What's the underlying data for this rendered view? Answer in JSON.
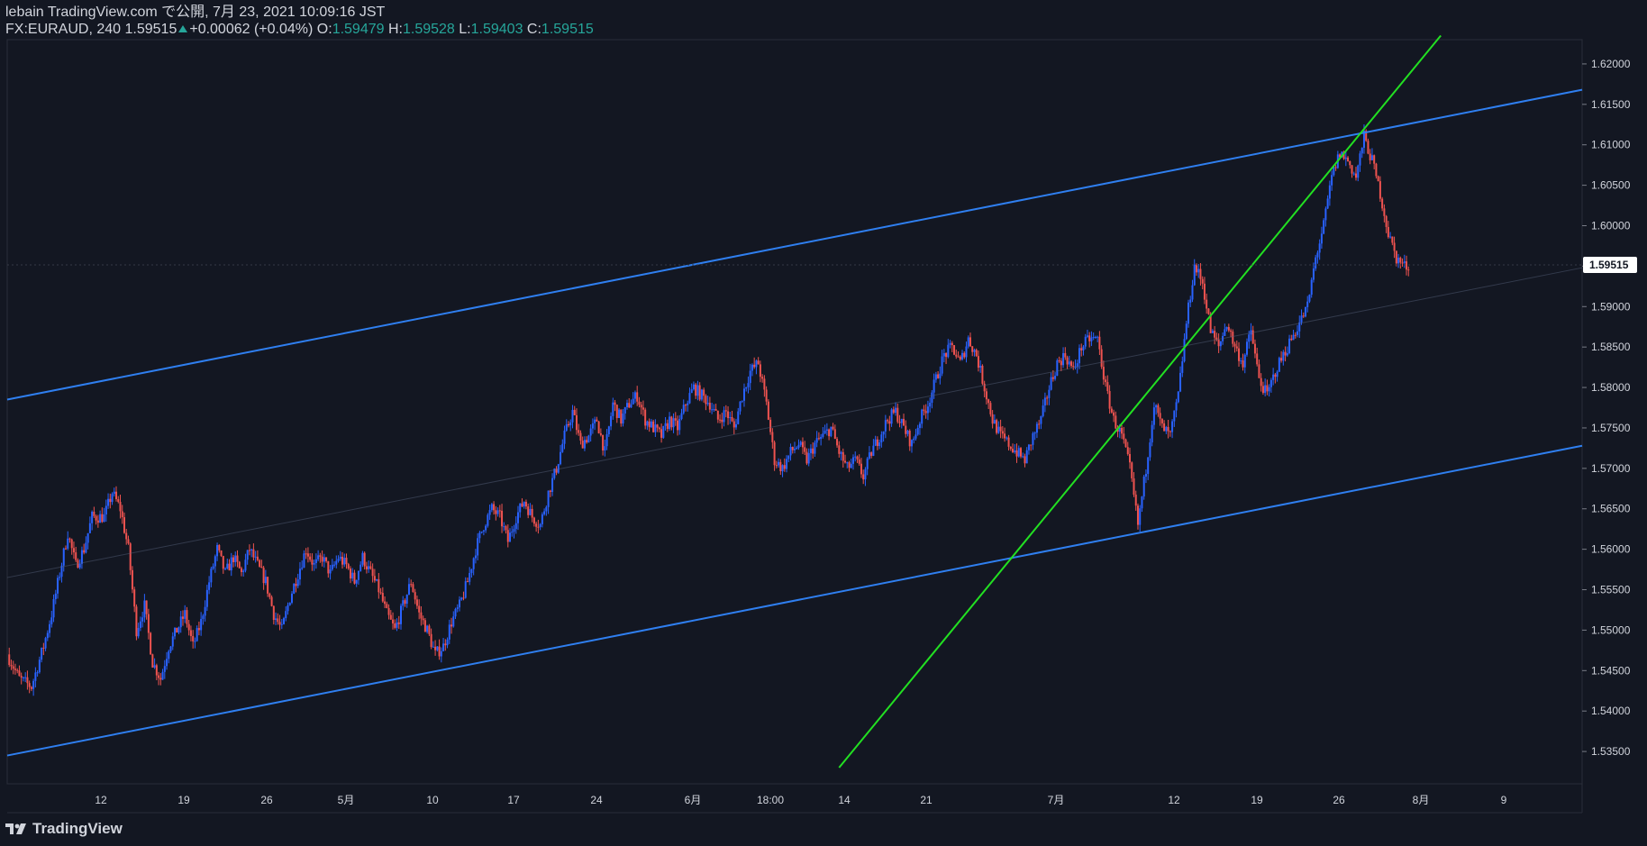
{
  "header": {
    "line1": "lebain TradingView.com で公開, 7月 23, 2021 10:09:16 JST",
    "symbol": "FX:EURAUD, 240",
    "last": "1.59515",
    "change": "+0.00062 (+0.04%)",
    "o_label": "O:",
    "o_val": "1.59479",
    "h_label": "H:",
    "h_val": "1.59528",
    "l_label": "L:",
    "l_val": "1.59403",
    "c_label": "C:",
    "c_val": "1.59515"
  },
  "brand": {
    "name": "TradingView",
    "icon": "tradingview-logo-icon"
  },
  "colors": {
    "background": "#131722",
    "up": "#2962ff",
    "down": "#ef5350",
    "channel": "#2f7ff0",
    "trendline": "#22e022",
    "price_badge": "#ffffff"
  },
  "chart_data": {
    "type": "candlestick",
    "timeframe": "240",
    "symbol": "FX:EURAUD",
    "ylim": [
      1.531,
      1.623
    ],
    "y_ticks": [
      "1.62000",
      "1.61500",
      "1.61000",
      "1.60500",
      "1.60000",
      "1.59500",
      "1.59000",
      "1.58500",
      "1.58000",
      "1.57500",
      "1.57000",
      "1.56500",
      "1.56000",
      "1.55500",
      "1.55000",
      "1.54500",
      "1.54000",
      "1.53500"
    ],
    "y_tick_values": [
      1.62,
      1.615,
      1.61,
      1.605,
      1.6,
      1.595,
      1.59,
      1.585,
      1.58,
      1.575,
      1.57,
      1.565,
      1.56,
      1.555,
      1.55,
      1.545,
      1.54,
      1.535
    ],
    "x_ticks": [
      "12",
      "19",
      "26",
      "5月",
      "10",
      "17",
      "24",
      "6月",
      "18:00",
      "14",
      "21",
      "7月",
      "12",
      "19",
      "26",
      "8月",
      "9"
    ],
    "last_price_label": "1.59515",
    "last_price": 1.59515,
    "close_path": [
      [
        0,
        1.547
      ],
      [
        6,
        1.544
      ],
      [
        12,
        1.543
      ],
      [
        18,
        1.548
      ],
      [
        22,
        1.552
      ],
      [
        26,
        1.557
      ],
      [
        30,
        1.562
      ],
      [
        34,
        1.558
      ],
      [
        38,
        1.56
      ],
      [
        42,
        1.564
      ],
      [
        48,
        1.564
      ],
      [
        52,
        1.567
      ],
      [
        56,
        1.565
      ],
      [
        60,
        1.56
      ],
      [
        64,
        1.55
      ],
      [
        68,
        1.553
      ],
      [
        72,
        1.546
      ],
      [
        76,
        1.544
      ],
      [
        80,
        1.548
      ],
      [
        84,
        1.55
      ],
      [
        88,
        1.552
      ],
      [
        92,
        1.548
      ],
      [
        96,
        1.551
      ],
      [
        100,
        1.556
      ],
      [
        104,
        1.56
      ],
      [
        108,
        1.557
      ],
      [
        112,
        1.559
      ],
      [
        116,
        1.557
      ],
      [
        120,
        1.56
      ],
      [
        124,
        1.558
      ],
      [
        128,
        1.556
      ],
      [
        132,
        1.552
      ],
      [
        136,
        1.55
      ],
      [
        140,
        1.554
      ],
      [
        144,
        1.557
      ],
      [
        148,
        1.56
      ],
      [
        152,
        1.558
      ],
      [
        156,
        1.559
      ],
      [
        160,
        1.557
      ],
      [
        164,
        1.559
      ],
      [
        168,
        1.558
      ],
      [
        172,
        1.556
      ],
      [
        176,
        1.559
      ],
      [
        180,
        1.557
      ],
      [
        184,
        1.555
      ],
      [
        188,
        1.552
      ],
      [
        192,
        1.55
      ],
      [
        196,
        1.553
      ],
      [
        200,
        1.556
      ],
      [
        204,
        1.552
      ],
      [
        208,
        1.55
      ],
      [
        212,
        1.547
      ],
      [
        216,
        1.548
      ],
      [
        220,
        1.551
      ],
      [
        224,
        1.553
      ],
      [
        228,
        1.556
      ],
      [
        232,
        1.56
      ],
      [
        236,
        1.563
      ],
      [
        240,
        1.565
      ],
      [
        244,
        1.564
      ],
      [
        248,
        1.561
      ],
      [
        252,
        1.564
      ],
      [
        256,
        1.566
      ],
      [
        260,
        1.564
      ],
      [
        264,
        1.563
      ],
      [
        268,
        1.567
      ],
      [
        272,
        1.57
      ],
      [
        276,
        1.574
      ],
      [
        280,
        1.577
      ],
      [
        284,
        1.573
      ],
      [
        288,
        1.574
      ],
      [
        292,
        1.576
      ],
      [
        296,
        1.572
      ],
      [
        300,
        1.578
      ],
      [
        304,
        1.576
      ],
      [
        308,
        1.578
      ],
      [
        312,
        1.579
      ],
      [
        316,
        1.576
      ],
      [
        320,
        1.575
      ],
      [
        324,
        1.574
      ],
      [
        328,
        1.576
      ],
      [
        332,
        1.575
      ],
      [
        336,
        1.578
      ],
      [
        340,
        1.58
      ],
      [
        344,
        1.579
      ],
      [
        348,
        1.578
      ],
      [
        352,
        1.576
      ],
      [
        356,
        1.577
      ],
      [
        360,
        1.575
      ],
      [
        364,
        1.579
      ],
      [
        368,
        1.582
      ],
      [
        372,
        1.583
      ],
      [
        376,
        1.578
      ],
      [
        380,
        1.571
      ],
      [
        384,
        1.57
      ],
      [
        388,
        1.572
      ],
      [
        392,
        1.573
      ],
      [
        396,
        1.571
      ],
      [
        400,
        1.573
      ],
      [
        404,
        1.574
      ],
      [
        408,
        1.575
      ],
      [
        412,
        1.572
      ],
      [
        416,
        1.57
      ],
      [
        420,
        1.571
      ],
      [
        424,
        1.569
      ],
      [
        428,
        1.572
      ],
      [
        432,
        1.574
      ],
      [
        436,
        1.576
      ],
      [
        440,
        1.577
      ],
      [
        444,
        1.575
      ],
      [
        448,
        1.573
      ],
      [
        452,
        1.576
      ],
      [
        456,
        1.578
      ],
      [
        460,
        1.581
      ],
      [
        464,
        1.584
      ],
      [
        468,
        1.585
      ],
      [
        472,
        1.583
      ],
      [
        476,
        1.586
      ],
      [
        480,
        1.584
      ],
      [
        484,
        1.58
      ],
      [
        488,
        1.576
      ],
      [
        492,
        1.574
      ],
      [
        496,
        1.573
      ],
      [
        500,
        1.572
      ],
      [
        504,
        1.571
      ],
      [
        508,
        1.574
      ],
      [
        512,
        1.576
      ],
      [
        516,
        1.58
      ],
      [
        520,
        1.583
      ],
      [
        524,
        1.584
      ],
      [
        528,
        1.582
      ],
      [
        532,
        1.585
      ],
      [
        536,
        1.586
      ],
      [
        540,
        1.586
      ],
      [
        544,
        1.58
      ],
      [
        548,
        1.576
      ],
      [
        552,
        1.574
      ],
      [
        556,
        1.57
      ],
      [
        560,
        1.563
      ],
      [
        564,
        1.57
      ],
      [
        568,
        1.578
      ],
      [
        572,
        1.575
      ],
      [
        576,
        1.574
      ],
      [
        580,
        1.579
      ],
      [
        584,
        1.588
      ],
      [
        588,
        1.595
      ],
      [
        592,
        1.593
      ],
      [
        596,
        1.587
      ],
      [
        600,
        1.585
      ],
      [
        604,
        1.588
      ],
      [
        608,
        1.585
      ],
      [
        612,
        1.583
      ],
      [
        616,
        1.587
      ],
      [
        620,
        1.581
      ],
      [
        624,
        1.579
      ],
      [
        628,
        1.582
      ],
      [
        632,
        1.584
      ],
      [
        636,
        1.586
      ],
      [
        640,
        1.588
      ],
      [
        644,
        1.59
      ],
      [
        648,
        1.596
      ],
      [
        652,
        1.6
      ],
      [
        656,
        1.606
      ],
      [
        660,
        1.609
      ],
      [
        664,
        1.608
      ],
      [
        668,
        1.606
      ],
      [
        672,
        1.611
      ],
      [
        676,
        1.608
      ],
      [
        680,
        1.604
      ],
      [
        684,
        1.599
      ],
      [
        688,
        1.596
      ],
      [
        692,
        1.595
      ],
      [
        694,
        1.5951
      ]
    ],
    "channel_upper": [
      [
        0,
        1.5785
      ],
      [
        780,
        1.6168
      ]
    ],
    "channel_lower": [
      [
        0,
        1.5345
      ],
      [
        780,
        1.5728
      ]
    ],
    "channel_middle": [
      [
        0,
        1.5565
      ],
      [
        780,
        1.5948
      ]
    ],
    "green_trendline": [
      [
        412,
        1.533
      ],
      [
        710,
        1.6235
      ]
    ],
    "xlim": [
      0,
      780
    ]
  }
}
